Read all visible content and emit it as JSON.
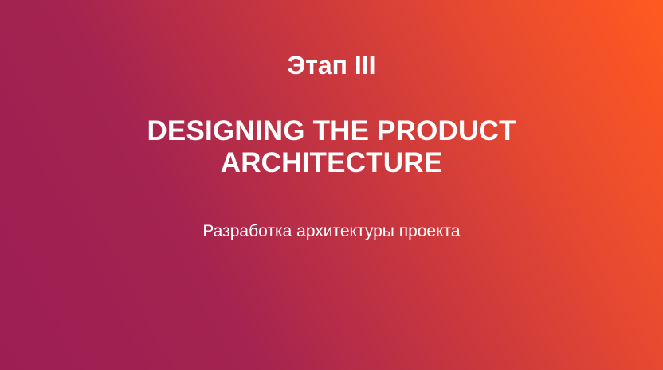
{
  "slide": {
    "stage": "Этап III",
    "title_lines": [
      "DESIGNING THE PRODUCT",
      "ARCHITECTURE"
    ],
    "subtitle": "Разработка архитектуры проекта"
  },
  "colors": {
    "gradient_start": "#9c1f52",
    "gradient_end": "#ff5a20",
    "text": "#ffffff"
  }
}
